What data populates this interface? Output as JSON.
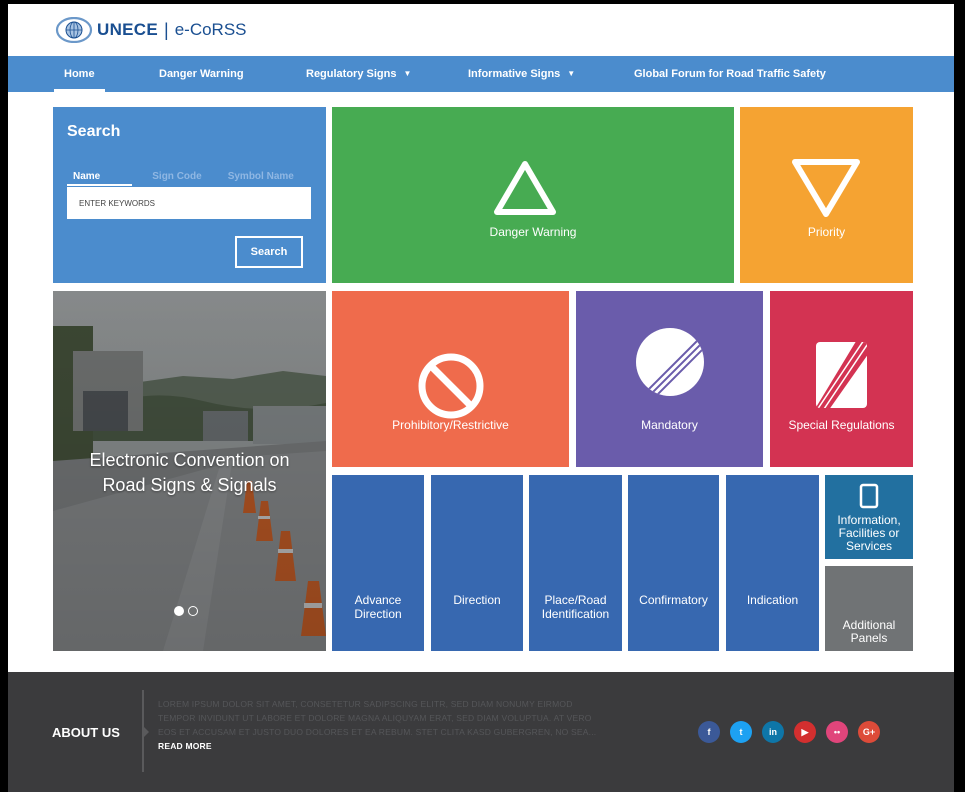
{
  "header": {
    "brand": "UNECE",
    "separator": "|",
    "product": "e-CoRSS"
  },
  "nav": {
    "items": [
      {
        "label": "Home",
        "active": true
      },
      {
        "label": "Danger Warning"
      },
      {
        "label": "Regulatory Signs",
        "dropdown": true
      },
      {
        "label": "Informative Signs",
        "dropdown": true
      },
      {
        "label": "Global Forum for Road Traffic Safety"
      }
    ]
  },
  "search": {
    "title": "Search",
    "tabs": [
      "Name",
      "Sign Code",
      "Symbol Name"
    ],
    "placeholder": "ENTER KEYWORDS",
    "button": "Search"
  },
  "tiles": {
    "danger": "Danger Warning",
    "priority": "Priority",
    "prohibitory": "Prohibitory/Restrictive",
    "mandatory": "Mandatory",
    "special": "Special Regulations",
    "advance_direction_l1": "Advance",
    "advance_direction_l2": "Direction",
    "direction": "Direction",
    "place_l1": "Place/Road",
    "place_l2": "Identification",
    "confirmatory": "Confirmatory",
    "indication": "Indication",
    "info_l1": "Information,",
    "info_l2": "Facilities or",
    "info_l3": "Services",
    "additional_l1": "Additional",
    "additional_l2": "Panels"
  },
  "hero": {
    "title_l1": "Electronic Convention on",
    "title_l2": "Road Signs & Signals"
  },
  "footer": {
    "about_label": "ABOUT US",
    "about_text": "LOREM IPSUM DOLOR SIT AMET, CONSETETUR SADIPSCING ELITR, SED DIAM NONUMY EIRMOD TEMPOR INVIDUNT UT LABORE ET DOLORE MAGNA ALIQUYAM ERAT, SED DIAM VOLUPTUA. AT VERO EOS ET ACCUSAM ET JUSTO DUO DOLORES ET EA REBUM. STET CLITA KASD GUBERGREN, NO SEA...",
    "read_more": "READ MORE",
    "socials": [
      {
        "icon": "facebook-icon",
        "glyph": "f",
        "color": "#3b5998"
      },
      {
        "icon": "twitter-icon",
        "glyph": "t",
        "color": "#1da1f2"
      },
      {
        "icon": "linkedin-icon",
        "glyph": "in",
        "color": "#0e76a8"
      },
      {
        "icon": "youtube-icon",
        "glyph": "▶",
        "color": "#d32f2f"
      },
      {
        "icon": "flickr-icon",
        "glyph": "••",
        "color": "#e0457b"
      },
      {
        "icon": "googleplus-icon",
        "glyph": "G+",
        "color": "#dd4b39"
      }
    ]
  },
  "colors": {
    "nav": "#4b8ccd",
    "danger": "#47ab52",
    "priority": "#f5a332",
    "prohibitory": "#ef6b4c",
    "mandatory": "#6a5cab",
    "special": "#d33352",
    "informative": "#3768b0",
    "footer": "#3b3b3d"
  }
}
